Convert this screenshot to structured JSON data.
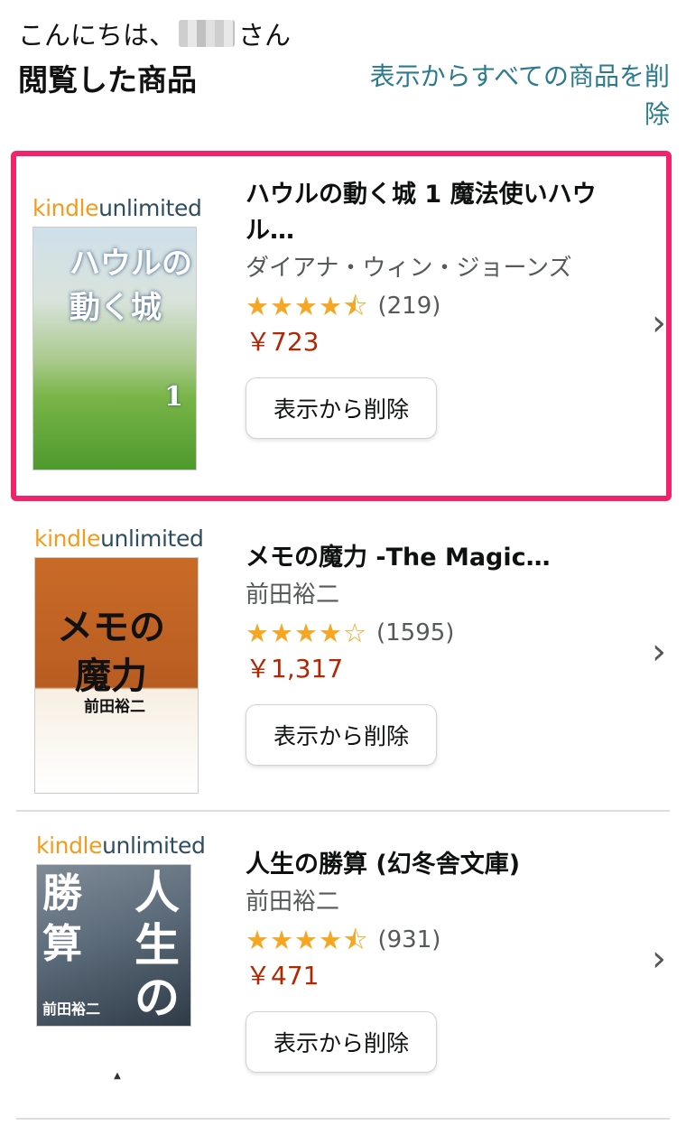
{
  "header": {
    "greeting_prefix": "こんにちは、",
    "greeting_suffix": "さん",
    "title": "閲覧した商品",
    "clear_all": "表示からすべての商品を削除"
  },
  "ku_logo": {
    "kindle": "kindle",
    "unlimited": "unlimited"
  },
  "products": [
    {
      "title": "ハウルの動く城 1 魔法使いハウル…",
      "author": "ダイアナ・ウィン・ジョーンズ",
      "rating": 4.5,
      "stars": "★★★★⯪",
      "review_count": "(219)",
      "price": "￥723",
      "remove_label": "表示から削除",
      "cover_title": "ハウルの動く城",
      "cover_number": "1",
      "highlighted": true
    },
    {
      "title": "メモの魔力 -The Magic…",
      "author": "前田裕二",
      "rating": 4,
      "stars": "★★★★☆",
      "review_count": "(1595)",
      "price": "￥1,317",
      "remove_label": "表示から削除",
      "cover_title_1": "メモの",
      "cover_title_2": "魔力",
      "cover_author": "前田裕二"
    },
    {
      "title": "人生の勝算 (幻冬舎文庫)",
      "author": "前田裕二",
      "rating": 4.5,
      "stars": "★★★★⯪",
      "review_count": "(931)",
      "price": "￥471",
      "remove_label": "表示から削除",
      "cover_left": "勝算",
      "cover_right": "人生の",
      "cover_author": "前田裕二"
    }
  ],
  "colors": {
    "highlight": "#f0236b",
    "link": "#2b7b8f",
    "price": "#b12704",
    "star": "#f5a623"
  }
}
